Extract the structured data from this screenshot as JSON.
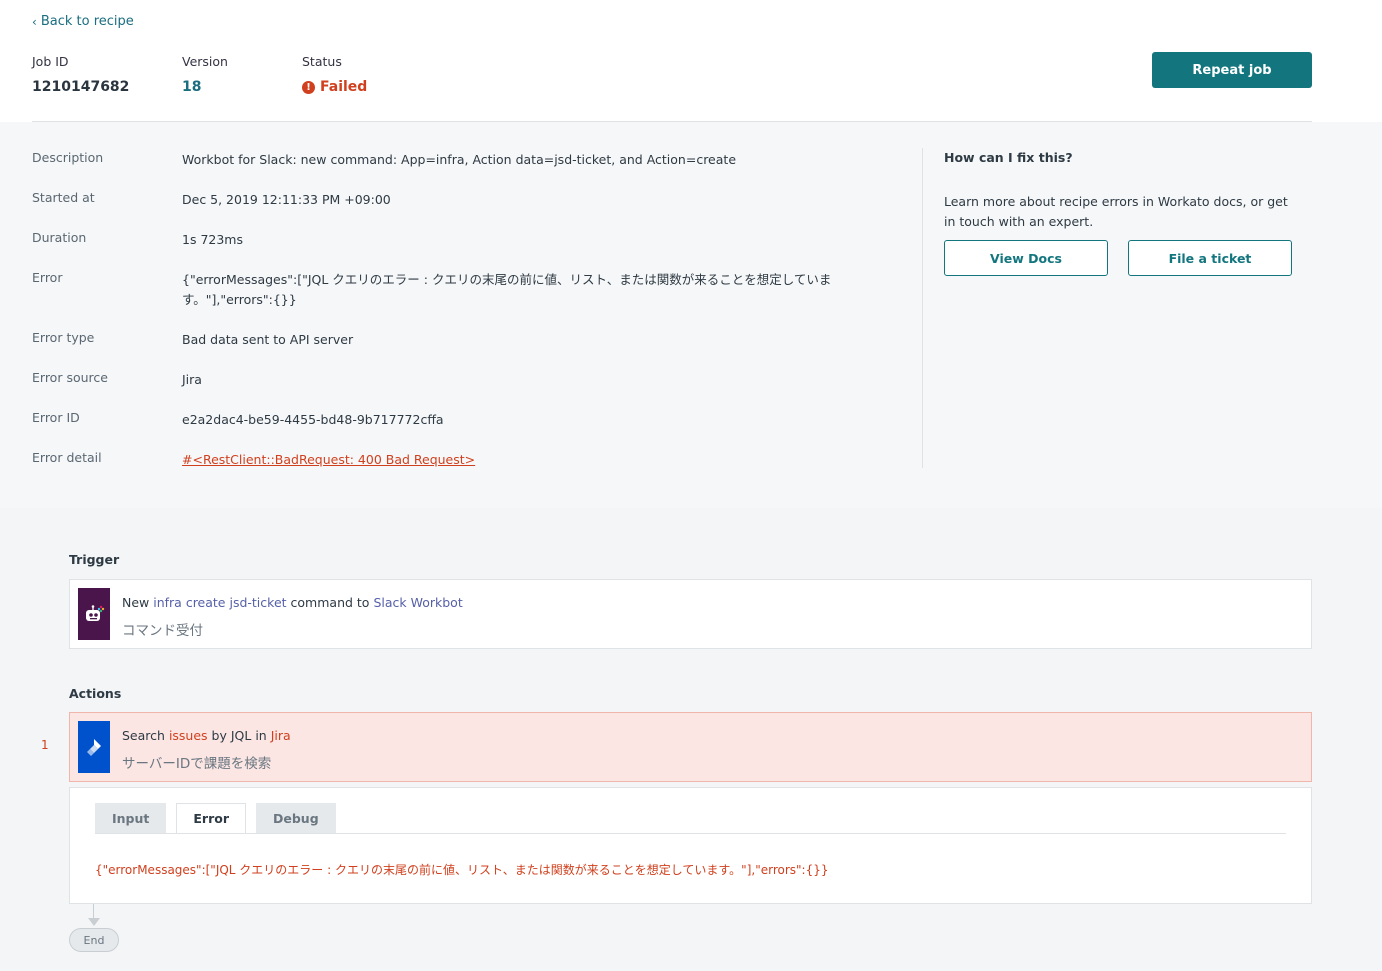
{
  "nav": {
    "back_label": "Back to recipe"
  },
  "job": {
    "job_id_label": "Job ID",
    "job_id": "1210147682",
    "version_label": "Version",
    "version": "18",
    "status_label": "Status",
    "status": "Failed",
    "repeat_label": "Repeat job"
  },
  "details": [
    {
      "key": "Description",
      "value": "Workbot for Slack: new command: App=infra, Action data=jsd-ticket, and Action=create"
    },
    {
      "key": "Started at",
      "value": "Dec 5, 2019 12:11:33 PM +09:00"
    },
    {
      "key": "Duration",
      "value": "1s 723ms"
    },
    {
      "key": "Error",
      "value": "{\"errorMessages\":[\"JQL クエリのエラー : クエリの末尾の前に値、リスト、または関数が来ることを想定しています。\"],\"errors\":{}}"
    },
    {
      "key": "Error type",
      "value": "Bad data sent to API server"
    },
    {
      "key": "Error source",
      "value": "Jira"
    },
    {
      "key": "Error ID",
      "value": "e2a2dac4-be59-4455-bd48-9b717772cffa"
    },
    {
      "key": "Error detail",
      "value": "#<RestClient::BadRequest: 400 Bad Request>"
    }
  ],
  "help": {
    "title": "How can I fix this?",
    "text": "Learn more about recipe errors in Workato docs, or get in touch with an expert.",
    "view_docs": "View Docs",
    "file_ticket": "File a ticket"
  },
  "trigger": {
    "section_title": "Trigger",
    "w1": "New",
    "hl1": "infra create jsd-ticket",
    "w2": "command to",
    "hl2": "Slack Workbot",
    "subtitle": "コマンド受付"
  },
  "actions": {
    "section_title": "Actions",
    "step_number": "1",
    "w1": "Search",
    "hl1": "issues",
    "w2": "by JQL in",
    "hl2": "Jira",
    "subtitle": "サーバーIDで課題を検索",
    "tabs": [
      "Input",
      "Error",
      "Debug"
    ],
    "active_tab": "Error",
    "error_text": "{\"errorMessages\":[\"JQL クエリのエラー : クエリの末尾の前に値、リスト、または関数が来ることを想定しています。\"],\"errors\":{}}"
  },
  "end_label": "End",
  "colors": {
    "accent": "#13767f",
    "error": "#d0401e",
    "slack_icon_bg": "#4a154b",
    "jira_icon_bg": "#0052cc"
  }
}
